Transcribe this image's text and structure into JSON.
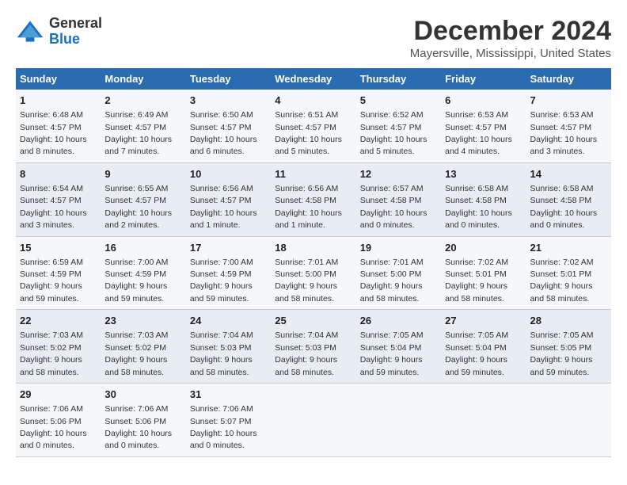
{
  "logo": {
    "line1": "General",
    "line2": "Blue"
  },
  "title": "December 2024",
  "subtitle": "Mayersville, Mississippi, United States",
  "weekdays": [
    "Sunday",
    "Monday",
    "Tuesday",
    "Wednesday",
    "Thursday",
    "Friday",
    "Saturday"
  ],
  "weeks": [
    [
      {
        "day": "1",
        "sunrise": "Sunrise: 6:48 AM",
        "sunset": "Sunset: 4:57 PM",
        "daylight": "Daylight: 10 hours and 8 minutes."
      },
      {
        "day": "2",
        "sunrise": "Sunrise: 6:49 AM",
        "sunset": "Sunset: 4:57 PM",
        "daylight": "Daylight: 10 hours and 7 minutes."
      },
      {
        "day": "3",
        "sunrise": "Sunrise: 6:50 AM",
        "sunset": "Sunset: 4:57 PM",
        "daylight": "Daylight: 10 hours and 6 minutes."
      },
      {
        "day": "4",
        "sunrise": "Sunrise: 6:51 AM",
        "sunset": "Sunset: 4:57 PM",
        "daylight": "Daylight: 10 hours and 5 minutes."
      },
      {
        "day": "5",
        "sunrise": "Sunrise: 6:52 AM",
        "sunset": "Sunset: 4:57 PM",
        "daylight": "Daylight: 10 hours and 5 minutes."
      },
      {
        "day": "6",
        "sunrise": "Sunrise: 6:53 AM",
        "sunset": "Sunset: 4:57 PM",
        "daylight": "Daylight: 10 hours and 4 minutes."
      },
      {
        "day": "7",
        "sunrise": "Sunrise: 6:53 AM",
        "sunset": "Sunset: 4:57 PM",
        "daylight": "Daylight: 10 hours and 3 minutes."
      }
    ],
    [
      {
        "day": "8",
        "sunrise": "Sunrise: 6:54 AM",
        "sunset": "Sunset: 4:57 PM",
        "daylight": "Daylight: 10 hours and 3 minutes."
      },
      {
        "day": "9",
        "sunrise": "Sunrise: 6:55 AM",
        "sunset": "Sunset: 4:57 PM",
        "daylight": "Daylight: 10 hours and 2 minutes."
      },
      {
        "day": "10",
        "sunrise": "Sunrise: 6:56 AM",
        "sunset": "Sunset: 4:57 PM",
        "daylight": "Daylight: 10 hours and 1 minute."
      },
      {
        "day": "11",
        "sunrise": "Sunrise: 6:56 AM",
        "sunset": "Sunset: 4:58 PM",
        "daylight": "Daylight: 10 hours and 1 minute."
      },
      {
        "day": "12",
        "sunrise": "Sunrise: 6:57 AM",
        "sunset": "Sunset: 4:58 PM",
        "daylight": "Daylight: 10 hours and 0 minutes."
      },
      {
        "day": "13",
        "sunrise": "Sunrise: 6:58 AM",
        "sunset": "Sunset: 4:58 PM",
        "daylight": "Daylight: 10 hours and 0 minutes."
      },
      {
        "day": "14",
        "sunrise": "Sunrise: 6:58 AM",
        "sunset": "Sunset: 4:58 PM",
        "daylight": "Daylight: 10 hours and 0 minutes."
      }
    ],
    [
      {
        "day": "15",
        "sunrise": "Sunrise: 6:59 AM",
        "sunset": "Sunset: 4:59 PM",
        "daylight": "Daylight: 9 hours and 59 minutes."
      },
      {
        "day": "16",
        "sunrise": "Sunrise: 7:00 AM",
        "sunset": "Sunset: 4:59 PM",
        "daylight": "Daylight: 9 hours and 59 minutes."
      },
      {
        "day": "17",
        "sunrise": "Sunrise: 7:00 AM",
        "sunset": "Sunset: 4:59 PM",
        "daylight": "Daylight: 9 hours and 59 minutes."
      },
      {
        "day": "18",
        "sunrise": "Sunrise: 7:01 AM",
        "sunset": "Sunset: 5:00 PM",
        "daylight": "Daylight: 9 hours and 58 minutes."
      },
      {
        "day": "19",
        "sunrise": "Sunrise: 7:01 AM",
        "sunset": "Sunset: 5:00 PM",
        "daylight": "Daylight: 9 hours and 58 minutes."
      },
      {
        "day": "20",
        "sunrise": "Sunrise: 7:02 AM",
        "sunset": "Sunset: 5:01 PM",
        "daylight": "Daylight: 9 hours and 58 minutes."
      },
      {
        "day": "21",
        "sunrise": "Sunrise: 7:02 AM",
        "sunset": "Sunset: 5:01 PM",
        "daylight": "Daylight: 9 hours and 58 minutes."
      }
    ],
    [
      {
        "day": "22",
        "sunrise": "Sunrise: 7:03 AM",
        "sunset": "Sunset: 5:02 PM",
        "daylight": "Daylight: 9 hours and 58 minutes."
      },
      {
        "day": "23",
        "sunrise": "Sunrise: 7:03 AM",
        "sunset": "Sunset: 5:02 PM",
        "daylight": "Daylight: 9 hours and 58 minutes."
      },
      {
        "day": "24",
        "sunrise": "Sunrise: 7:04 AM",
        "sunset": "Sunset: 5:03 PM",
        "daylight": "Daylight: 9 hours and 58 minutes."
      },
      {
        "day": "25",
        "sunrise": "Sunrise: 7:04 AM",
        "sunset": "Sunset: 5:03 PM",
        "daylight": "Daylight: 9 hours and 58 minutes."
      },
      {
        "day": "26",
        "sunrise": "Sunrise: 7:05 AM",
        "sunset": "Sunset: 5:04 PM",
        "daylight": "Daylight: 9 hours and 59 minutes."
      },
      {
        "day": "27",
        "sunrise": "Sunrise: 7:05 AM",
        "sunset": "Sunset: 5:04 PM",
        "daylight": "Daylight: 9 hours and 59 minutes."
      },
      {
        "day": "28",
        "sunrise": "Sunrise: 7:05 AM",
        "sunset": "Sunset: 5:05 PM",
        "daylight": "Daylight: 9 hours and 59 minutes."
      }
    ],
    [
      {
        "day": "29",
        "sunrise": "Sunrise: 7:06 AM",
        "sunset": "Sunset: 5:06 PM",
        "daylight": "Daylight: 10 hours and 0 minutes."
      },
      {
        "day": "30",
        "sunrise": "Sunrise: 7:06 AM",
        "sunset": "Sunset: 5:06 PM",
        "daylight": "Daylight: 10 hours and 0 minutes."
      },
      {
        "day": "31",
        "sunrise": "Sunrise: 7:06 AM",
        "sunset": "Sunset: 5:07 PM",
        "daylight": "Daylight: 10 hours and 0 minutes."
      },
      null,
      null,
      null,
      null
    ]
  ]
}
